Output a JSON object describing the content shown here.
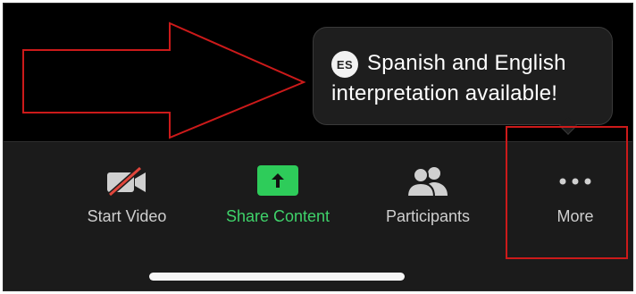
{
  "tooltip": {
    "avatar_initials": "ES",
    "line1": "Spanish and English",
    "line2": "interpretation available!"
  },
  "toolbar": {
    "items": [
      {
        "label": "Start Video",
        "icon": "video-off-icon"
      },
      {
        "label": "Share Content",
        "icon": "share-arrow-icon"
      },
      {
        "label": "Participants",
        "icon": "participants-icon"
      },
      {
        "label": "More",
        "icon": "more-dots-icon"
      }
    ]
  },
  "colors": {
    "background": "#000000",
    "toolbar": "#1b1b1b",
    "accent_green": "#2ecc5a",
    "annotation_red": "#cc1a1a",
    "video_off_slash": "#e0463c"
  }
}
